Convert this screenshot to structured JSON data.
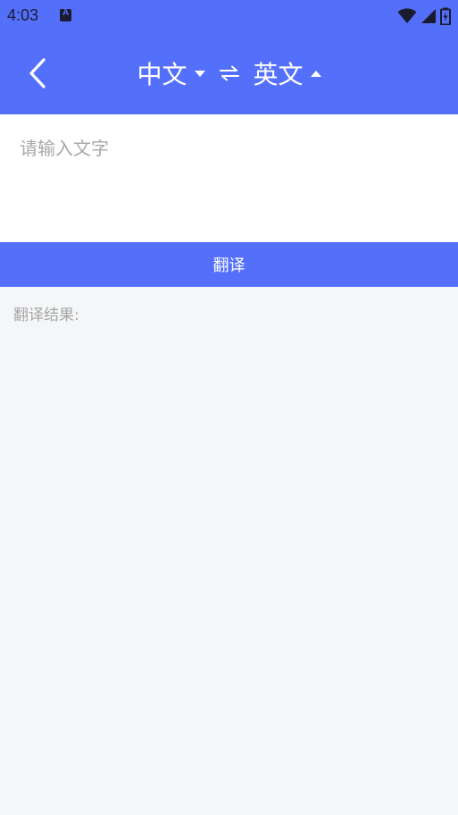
{
  "status_bar": {
    "time": "4:03",
    "icons": [
      "app-notification-icon",
      "wifi-icon",
      "signal-icon",
      "battery-icon"
    ]
  },
  "header": {
    "back_icon": "chevron-left-icon",
    "source_language": "中文",
    "target_language": "英文",
    "swap_icon": "swap-arrows-icon"
  },
  "input": {
    "value": "",
    "placeholder": "请输入文字"
  },
  "translate_button": {
    "label": "翻译"
  },
  "result": {
    "label": "翻译结果:"
  },
  "colors": {
    "primary": "#5470fa",
    "background": "#f4f6f8",
    "placeholder": "#a8a8a8",
    "result_label": "#a6a6a6"
  }
}
